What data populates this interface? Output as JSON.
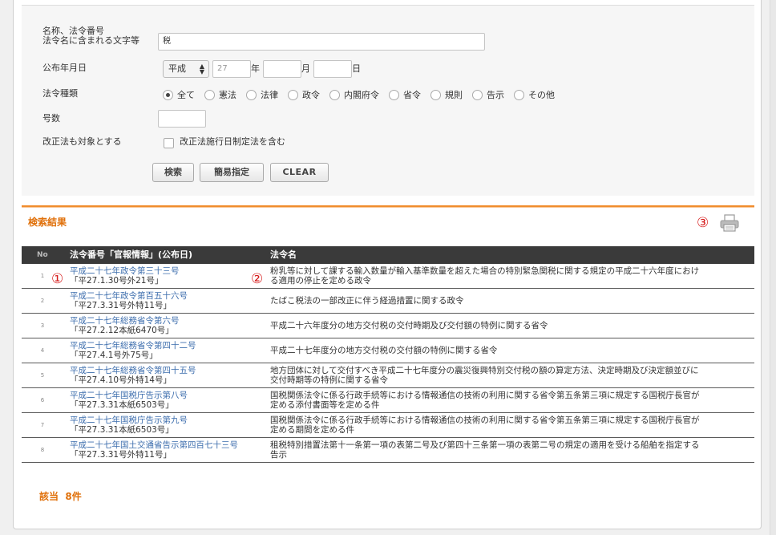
{
  "form": {
    "name_label_line1": "名称、法令番号",
    "name_label_line2": "法令名に含まれる文字等",
    "name_value": "税",
    "date_label": "公布年月日",
    "era_value": "平成",
    "year_value": "27",
    "year_unit": "年",
    "month_value": "",
    "month_unit": "月",
    "day_value": "",
    "day_unit": "日",
    "type_label": "法令種類",
    "types": [
      "全て",
      "憲法",
      "法律",
      "政令",
      "内閣府令",
      "省令",
      "規則",
      "告示",
      "その他"
    ],
    "selected_type": "全て",
    "number_label": "号数",
    "number_value": "",
    "amend_label": "改正法も対象とする",
    "amend_checkbox_label": "改正法施行日制定法を含む",
    "search_button": "検索",
    "simple_button": "簡易指定",
    "clear_button": "CLEAR"
  },
  "results": {
    "title": "検索結果",
    "annotation_1": "①",
    "annotation_2": "②",
    "annotation_3": "③",
    "columns": {
      "no": "No",
      "law": "法令番号「官報情報」(公布日)",
      "title": "法令名"
    },
    "rows": [
      {
        "no": "1",
        "law": "平成二十七年政令第三十三号",
        "ref": "「平27.1.30号外21号」",
        "title": "粉乳等に対して課する輸入数量が輸入基準数量を超えた場合の特別緊急関税に関する規定の平成二十六年度における適用の停止を定める政令"
      },
      {
        "no": "2",
        "law": "平成二十七年政令第百五十六号",
        "ref": "「平27.3.31号外特11号」",
        "title": "たばこ税法の一部改正に伴う経過措置に関する政令"
      },
      {
        "no": "3",
        "law": "平成二十七年総務省令第六号",
        "ref": "「平27.2.12本紙6470号」",
        "title": "平成二十六年度分の地方交付税の交付時期及び交付額の特例に関する省令"
      },
      {
        "no": "4",
        "law": "平成二十七年総務省令第四十二号",
        "ref": "「平27.4.1号外75号」",
        "title": "平成二十七年度分の地方交付税の交付額の特例に関する省令"
      },
      {
        "no": "5",
        "law": "平成二十七年総務省令第四十五号",
        "ref": "「平27.4.10号外特14号」",
        "title": "地方団体に対して交付すべき平成二十七年度分の震災復興特別交付税の額の算定方法、決定時期及び決定額並びに交付時期等の特例に関する省令"
      },
      {
        "no": "6",
        "law": "平成二十七年国税庁告示第八号",
        "ref": "「平27.3.31本紙6503号」",
        "title": "国税関係法令に係る行政手続等における情報通信の技術の利用に関する省令第五条第三項に規定する国税庁長官が定める添付書面等を定める件"
      },
      {
        "no": "7",
        "law": "平成二十七年国税庁告示第九号",
        "ref": "「平27.3.31本紙6503号」",
        "title": "国税関係法令に係る行政手続等における情報通信の技術の利用に関する省令第五条第三項に規定する国税庁長官が定める期間を定める件"
      },
      {
        "no": "8",
        "law": "平成二十七年国土交通省告示第四百七十三号",
        "ref": "「平27.3.31号外特11号」",
        "title": "租税特別措置法第十一条第一項の表第二号及び第四十三条第一項の表第二号の規定の適用を受ける船舶を指定する告示"
      }
    ],
    "count_label": "該当",
    "count_value": "8件"
  }
}
